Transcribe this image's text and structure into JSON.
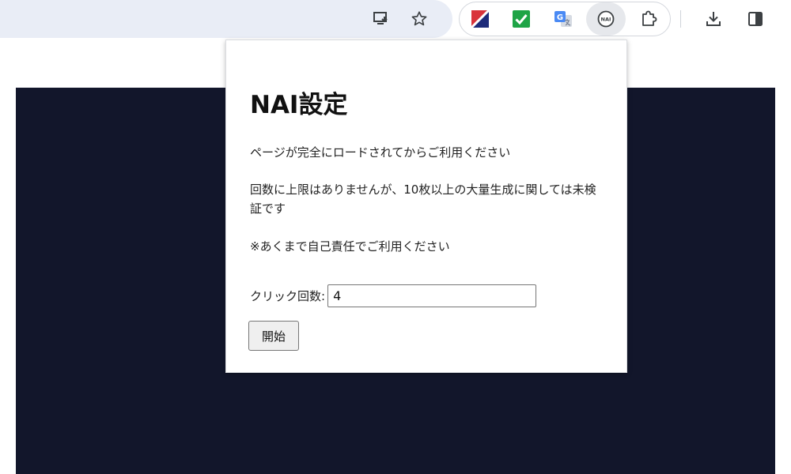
{
  "toolbar": {
    "omnibox_icons": [
      "install-app-icon",
      "bookmark-star-icon"
    ],
    "extensions": [
      "ext-stripe-icon",
      "ext-check-icon",
      "google-translate-icon",
      "nai-extension-icon"
    ],
    "nai_badge_text": "NAI",
    "right_icons": [
      "extensions-puzzle-icon",
      "download-icon",
      "side-panel-icon"
    ]
  },
  "colors": {
    "page_background": "#12162b",
    "omnibox": "#e9edf6",
    "check_green": "#1ea446",
    "translate_blue": "#4a8af4"
  },
  "popup": {
    "title": "NAI設定",
    "notice_1": "ページが完全にロードされてからご利用ください",
    "notice_2": "回数に上限はありませんが、10枚以上の大量生成に関しては未検証です",
    "notice_3": "※あくまで自己責任でご利用ください",
    "count_label": "クリック回数:",
    "count_value": "4",
    "start_button": "開始"
  }
}
